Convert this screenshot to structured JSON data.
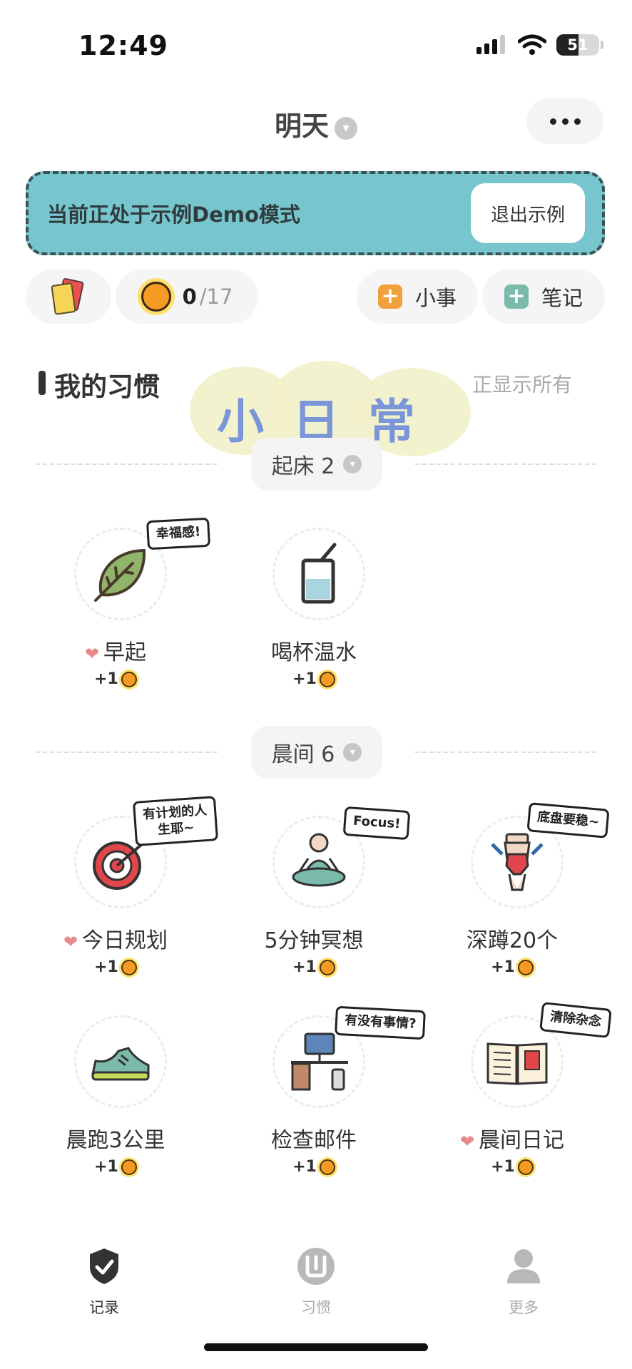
{
  "status_bar": {
    "time": "12:49",
    "battery": "51"
  },
  "header": {
    "title": "明天"
  },
  "demo_banner": {
    "text": "当前正处于示例Demo模式",
    "exit_label": "退出示例"
  },
  "toolbar": {
    "sun_count": "0",
    "sun_total": "/17",
    "small_task_label": "小事",
    "note_label": "笔记"
  },
  "section": {
    "title": "我的习惯",
    "filter_label": "正显示所有",
    "watermark_text": "小日常"
  },
  "groups": [
    {
      "label": "起床 2",
      "habits": [
        {
          "name": "早起",
          "reward": "+1",
          "favorite": true,
          "bubble": "幸福感!",
          "icon": "leaf-icon"
        },
        {
          "name": "喝杯温水",
          "reward": "+1",
          "favorite": false,
          "bubble": "",
          "icon": "water-glass-icon"
        }
      ]
    },
    {
      "label": "晨间 6",
      "habits": [
        {
          "name": "今日规划",
          "reward": "+1",
          "favorite": true,
          "bubble": "有计划的人\n生耶~",
          "icon": "target-icon"
        },
        {
          "name": "5分钟冥想",
          "reward": "+1",
          "favorite": false,
          "bubble": "Focus!",
          "icon": "meditation-icon"
        },
        {
          "name": "深蹲20个",
          "reward": "+1",
          "favorite": false,
          "bubble": "底盘要稳~",
          "icon": "squat-icon"
        },
        {
          "name": "晨跑3公里",
          "reward": "+1",
          "favorite": false,
          "bubble": "",
          "icon": "running-shoe-icon"
        },
        {
          "name": "检查邮件",
          "reward": "+1",
          "favorite": false,
          "bubble": "有没有事情?",
          "icon": "computer-desk-icon"
        },
        {
          "name": "晨间日记",
          "reward": "+1",
          "favorite": true,
          "bubble": "清除杂念",
          "icon": "open-book-icon"
        }
      ]
    }
  ],
  "bottom_nav": [
    {
      "label": "记录",
      "icon": "shield-check-icon",
      "active": true
    },
    {
      "label": "习惯",
      "icon": "habit-icon",
      "active": false
    },
    {
      "label": "更多",
      "icon": "person-icon",
      "active": false
    }
  ],
  "colors": {
    "banner_bg": "#78c6cd",
    "accent_orange": "#f2a03b",
    "accent_green": "#7bb9aa",
    "heart": "#e88a8c",
    "watermark": "#7b95d9"
  }
}
